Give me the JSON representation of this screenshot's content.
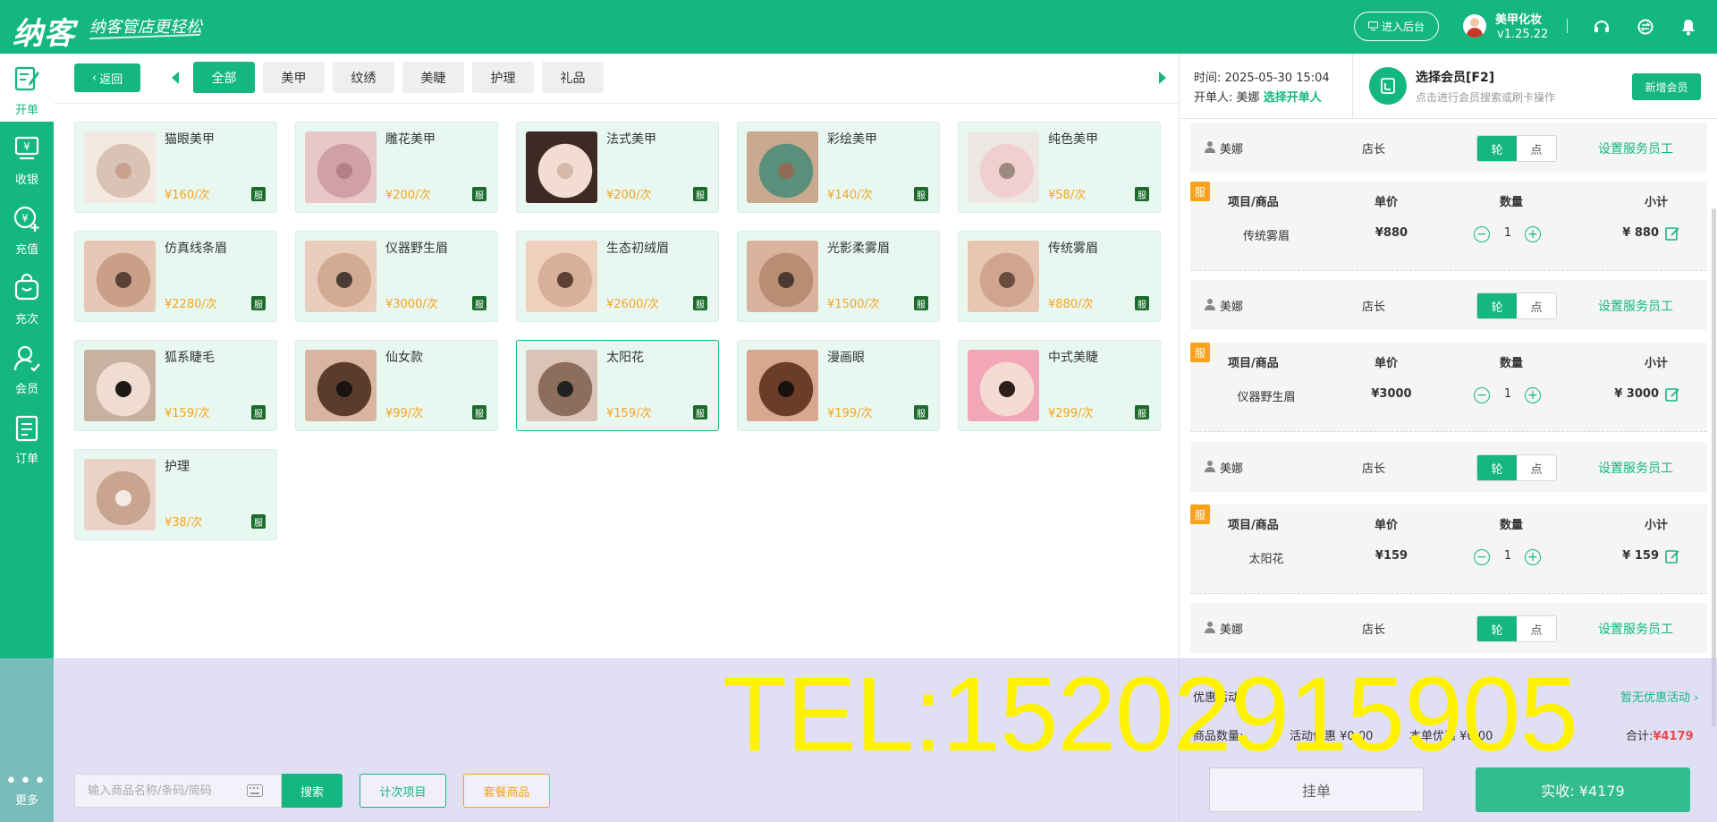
{
  "header": {
    "logo": "纳客",
    "slogan": "纳客管店更轻松",
    "backend_label": "进入后台",
    "store_name": "美甲化妆",
    "version": "v1.25.22"
  },
  "sidebar": {
    "items": [
      {
        "label": "开单"
      },
      {
        "label": "收银"
      },
      {
        "label": "充值"
      },
      {
        "label": "充次"
      },
      {
        "label": "会员"
      },
      {
        "label": "订单"
      }
    ],
    "more_label": "更多"
  },
  "main": {
    "back_label": "返回",
    "tabs": [
      "全部",
      "美甲",
      "纹绣",
      "美睫",
      "护理",
      "礼品"
    ],
    "products": [
      {
        "name": "猫眼美甲",
        "price": "¥160/次",
        "badge": "服"
      },
      {
        "name": "雕花美甲",
        "price": "¥200/次",
        "badge": "服"
      },
      {
        "name": "法式美甲",
        "price": "¥200/次",
        "badge": "服"
      },
      {
        "name": "彩绘美甲",
        "price": "¥140/次",
        "badge": "服"
      },
      {
        "name": "纯色美甲",
        "price": "¥58/次",
        "badge": "服"
      },
      {
        "name": "仿真线条眉",
        "price": "¥2280/次",
        "badge": "服"
      },
      {
        "name": "仪器野生眉",
        "price": "¥3000/次",
        "badge": "服"
      },
      {
        "name": "生态初绒眉",
        "price": "¥2600/次",
        "badge": "服"
      },
      {
        "name": "光影柔雾眉",
        "price": "¥1500/次",
        "badge": "服"
      },
      {
        "name": "传统雾眉",
        "price": "¥880/次",
        "badge": "服"
      },
      {
        "name": "狐系睫毛",
        "price": "¥159/次",
        "badge": "服"
      },
      {
        "name": "仙女款",
        "price": "¥99/次",
        "badge": "服"
      },
      {
        "name": "太阳花",
        "price": "¥159/次",
        "badge": "服"
      },
      {
        "name": "漫画眼",
        "price": "¥199/次",
        "badge": "服"
      },
      {
        "name": "中式美睫",
        "price": "¥299/次",
        "badge": "服"
      },
      {
        "name": "护理",
        "price": "¥38/次",
        "badge": "服"
      }
    ]
  },
  "order": {
    "time_label": "时间:",
    "time_value": "2025-05-30 15:04",
    "opener_label": "开单人:",
    "opener_name": "美娜",
    "opener_link": "选择开单人",
    "member_title": "选择会员[F2]",
    "member_hint": "点击进行会员搜索或刷卡操作",
    "new_member_label": "新增会员",
    "headers": {
      "item": "项目/商品",
      "price": "单价",
      "qty": "数量",
      "subtotal": "小计"
    },
    "staff": {
      "name": "美娜",
      "role": "店长",
      "seg_on": "轮",
      "seg_off": "点",
      "set_label": "设置服务员工"
    },
    "lines": [
      {
        "badge": "服",
        "name": "传统雾眉",
        "price": "¥880",
        "qty": "1",
        "subtotal": "¥ 880"
      },
      {
        "badge": "服",
        "name": "仪器野生眉",
        "price": "¥3000",
        "qty": "1",
        "subtotal": "¥ 3000"
      },
      {
        "badge": "服",
        "name": "太阳花",
        "price": "¥159",
        "qty": "1",
        "subtotal": "¥ 159"
      }
    ],
    "promo_label": "优惠活动",
    "promo_link": "暂无优惠活动",
    "stats": {
      "qty_label": "商品数量:",
      "discount_label": "活动优惠",
      "discount_value": "¥0.00",
      "single_label": "本单优惠",
      "single_value": "¥0.00",
      "total_label": "合计:",
      "total_value": "¥4179"
    },
    "hold_label": "挂单",
    "pay_label": "实收: ¥4179"
  },
  "bottom": {
    "search_placeholder": "输入商品名称/条码/简码",
    "search_label": "搜索",
    "count_label": "计次项目",
    "package_label": "套餐商品"
  },
  "watermark": "TEL:15202915905",
  "colors": {
    "brand": "#14b77f",
    "price": "#f7a21a",
    "badge_fu": "#f7a21a",
    "total": "#e84a4a",
    "watermark": "#fff200"
  }
}
